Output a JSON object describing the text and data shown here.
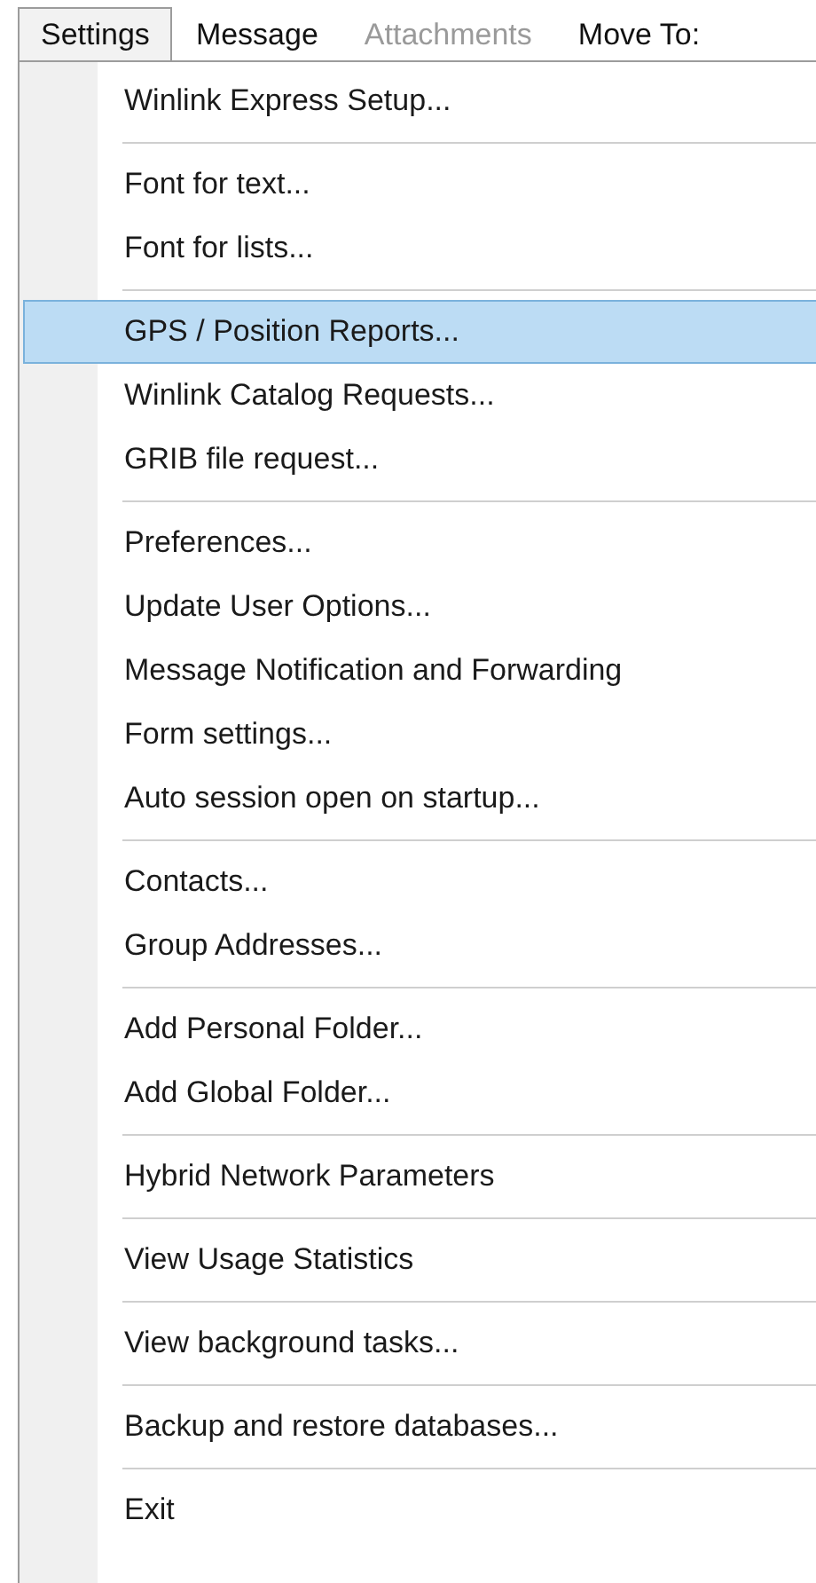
{
  "menu_bar": [
    {
      "label": "Settings",
      "selected": true,
      "disabled": false
    },
    {
      "label": "Message",
      "selected": false,
      "disabled": false
    },
    {
      "label": "Attachments",
      "selected": false,
      "disabled": true
    },
    {
      "label": "Move To:",
      "selected": false,
      "disabled": false
    }
  ],
  "menu": {
    "sections": [
      {
        "items": [
          {
            "label": "Winlink Express Setup...",
            "highlighted": false
          }
        ]
      },
      {
        "items": [
          {
            "label": "Font for text...",
            "highlighted": false
          },
          {
            "label": "Font for lists...",
            "highlighted": false
          }
        ]
      },
      {
        "items": [
          {
            "label": "GPS / Position Reports...",
            "highlighted": true
          },
          {
            "label": "Winlink Catalog Requests...",
            "highlighted": false
          },
          {
            "label": "GRIB file request...",
            "highlighted": false
          }
        ]
      },
      {
        "items": [
          {
            "label": "Preferences...",
            "highlighted": false
          },
          {
            "label": "Update User Options...",
            "highlighted": false
          },
          {
            "label": "Message Notification and Forwarding",
            "highlighted": false
          },
          {
            "label": "Form settings...",
            "highlighted": false
          },
          {
            "label": "Auto session open on startup...",
            "highlighted": false
          }
        ]
      },
      {
        "items": [
          {
            "label": "Contacts...",
            "highlighted": false
          },
          {
            "label": "Group Addresses...",
            "highlighted": false
          }
        ]
      },
      {
        "items": [
          {
            "label": "Add Personal Folder...",
            "highlighted": false
          },
          {
            "label": "Add Global Folder...",
            "highlighted": false
          }
        ]
      },
      {
        "items": [
          {
            "label": "Hybrid Network Parameters",
            "highlighted": false
          }
        ]
      },
      {
        "items": [
          {
            "label": "View Usage Statistics",
            "highlighted": false
          }
        ]
      },
      {
        "items": [
          {
            "label": "View background tasks...",
            "highlighted": false
          }
        ]
      },
      {
        "items": [
          {
            "label": "Backup and restore databases...",
            "highlighted": false
          }
        ]
      },
      {
        "items": [
          {
            "label": "Exit",
            "highlighted": false
          }
        ]
      }
    ]
  }
}
